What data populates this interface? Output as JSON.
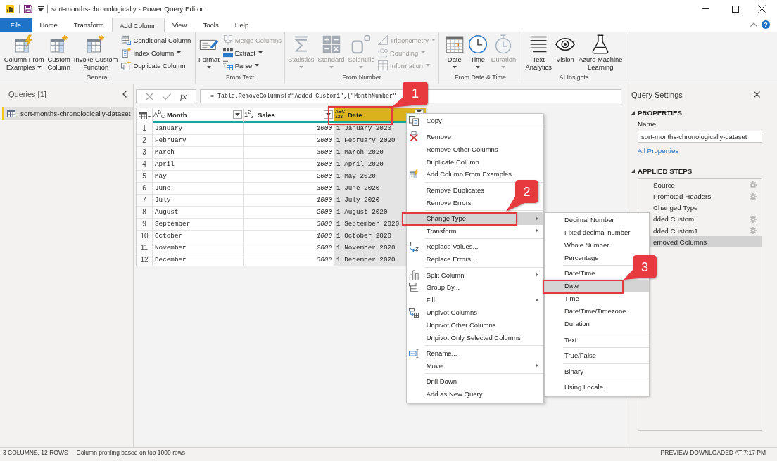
{
  "window": {
    "title": "sort-months-chronologically - Power Query Editor"
  },
  "tabs": [
    {
      "label": "File",
      "kind": "file",
      "selected": false
    },
    {
      "label": "Home",
      "kind": "tab",
      "selected": false
    },
    {
      "label": "Transform",
      "kind": "tab",
      "selected": false
    },
    {
      "label": "Add Column",
      "kind": "tab",
      "selected": true
    },
    {
      "label": "View",
      "kind": "tab",
      "selected": false
    },
    {
      "label": "Tools",
      "kind": "tab",
      "selected": false
    },
    {
      "label": "Help",
      "kind": "tab",
      "selected": false
    }
  ],
  "help_button": "?",
  "ribbon": {
    "groups": [
      {
        "label": "General",
        "large": [
          {
            "lines": [
              "Column From",
              "Examples"
            ],
            "dropdown": true,
            "disabled": false
          },
          {
            "lines": [
              "Custom",
              "Column"
            ],
            "dropdown": false,
            "disabled": false
          },
          {
            "lines": [
              "Invoke Custom",
              "Function"
            ],
            "dropdown": false,
            "disabled": false
          }
        ],
        "small": [
          {
            "label": "Conditional Column",
            "dropdown": false,
            "disabled": false
          },
          {
            "label": "Index Column",
            "dropdown": true,
            "disabled": false
          },
          {
            "label": "Duplicate Column",
            "dropdown": false,
            "disabled": false
          }
        ]
      },
      {
        "label": "From Text",
        "large": [
          {
            "lines": [
              "Format"
            ],
            "dropdown": true,
            "disabled": false
          }
        ],
        "small": [
          {
            "label": "Merge Columns",
            "dropdown": false,
            "disabled": true
          },
          {
            "label": "Extract",
            "dropdown": true,
            "disabled": false
          },
          {
            "label": "Parse",
            "dropdown": true,
            "disabled": false
          }
        ]
      },
      {
        "label": "From Number",
        "large": [
          {
            "lines": [
              "Statistics"
            ],
            "dropdown": true,
            "disabled": true
          },
          {
            "lines": [
              "Standard"
            ],
            "dropdown": true,
            "disabled": true
          },
          {
            "lines": [
              "Scientific"
            ],
            "dropdown": true,
            "disabled": true
          }
        ],
        "small": [
          {
            "label": "Trigonometry",
            "dropdown": true,
            "disabled": true
          },
          {
            "label": "Rounding",
            "dropdown": true,
            "disabled": true
          },
          {
            "label": "Information",
            "dropdown": true,
            "disabled": true
          }
        ]
      },
      {
        "label": "From Date & Time",
        "large": [
          {
            "lines": [
              "Date"
            ],
            "dropdown": true,
            "disabled": false
          },
          {
            "lines": [
              "Time"
            ],
            "dropdown": true,
            "disabled": false
          },
          {
            "lines": [
              "Duration"
            ],
            "dropdown": true,
            "disabled": true
          }
        ]
      },
      {
        "label": "AI Insights",
        "large": [
          {
            "lines": [
              "Text",
              "Analytics"
            ],
            "dropdown": false,
            "disabled": false
          },
          {
            "lines": [
              "Vision"
            ],
            "dropdown": false,
            "disabled": false
          },
          {
            "lines": [
              "Azure Machine",
              "Learning"
            ],
            "dropdown": false,
            "disabled": false
          }
        ]
      }
    ]
  },
  "queries": {
    "title": "Queries [1]",
    "items": [
      {
        "label": "sort-months-chronologically-dataset",
        "selected": true
      }
    ]
  },
  "formula_bar": {
    "function_button": "fx",
    "formula": "= Table.RemoveColumns(#\"Added Custom1\",{\"MonthNumber\""
  },
  "table": {
    "columns": [
      {
        "type_label": "A$^{B}$$_{C}$",
        "name": "Month",
        "kind": "text",
        "selected": false
      },
      {
        "type_label": "1$^{2}$$_{3}$",
        "name": "Sales",
        "kind": "number",
        "selected": false
      },
      {
        "type_label": "ABC 123",
        "name": "Date",
        "kind": "any",
        "selected": true
      }
    ],
    "rows": [
      {
        "number": "1",
        "cells": [
          "January",
          "1000",
          "1 January 2020"
        ]
      },
      {
        "number": "2",
        "cells": [
          "February",
          "2000",
          "1 February 2020"
        ]
      },
      {
        "number": "3",
        "cells": [
          "March",
          "3000",
          "1 March 2020"
        ]
      },
      {
        "number": "4",
        "cells": [
          "April",
          "1000",
          "1 April 2020"
        ]
      },
      {
        "number": "5",
        "cells": [
          "May",
          "2000",
          "1 May 2020"
        ]
      },
      {
        "number": "6",
        "cells": [
          "June",
          "3000",
          "1 June 2020"
        ]
      },
      {
        "number": "7",
        "cells": [
          "July",
          "1000",
          "1 July 2020"
        ]
      },
      {
        "number": "8",
        "cells": [
          "August",
          "2000",
          "1 August 2020"
        ]
      },
      {
        "number": "9",
        "cells": [
          "September",
          "3000",
          "1 September 2020"
        ]
      },
      {
        "number": "10",
        "cells": [
          "October",
          "1000",
          "1 October 2020"
        ]
      },
      {
        "number": "11",
        "cells": [
          "November",
          "2000",
          "1 November 2020"
        ]
      },
      {
        "number": "12",
        "cells": [
          "December",
          "3000",
          "1 December 2020"
        ]
      }
    ]
  },
  "context_menu": {
    "groups": [
      [
        {
          "label": "Copy",
          "has_submenu": false,
          "selected": false
        }
      ],
      [
        {
          "label": "Remove",
          "has_submenu": false,
          "selected": false
        },
        {
          "label": "Remove Other Columns",
          "has_submenu": false,
          "selected": false
        },
        {
          "label": "Duplicate Column",
          "has_submenu": false,
          "selected": false
        },
        {
          "label": "Add Column From Examples...",
          "has_submenu": false,
          "selected": false
        }
      ],
      [
        {
          "label": "Remove Duplicates",
          "has_submenu": false,
          "selected": false
        },
        {
          "label": "Remove Errors",
          "has_submenu": false,
          "selected": false
        }
      ],
      [
        {
          "label": "Change Type",
          "has_submenu": true,
          "selected": true
        },
        {
          "label": "Transform",
          "has_submenu": true,
          "selected": false
        }
      ],
      [
        {
          "label": "Replace Values...",
          "has_submenu": false,
          "selected": false
        },
        {
          "label": "Replace Errors...",
          "has_submenu": false,
          "selected": false
        }
      ],
      [
        {
          "label": "Split Column",
          "has_submenu": true,
          "selected": false
        },
        {
          "label": "Group By...",
          "has_submenu": false,
          "selected": false
        },
        {
          "label": "Fill",
          "has_submenu": true,
          "selected": false
        },
        {
          "label": "Unpivot Columns",
          "has_submenu": false,
          "selected": false
        },
        {
          "label": "Unpivot Other Columns",
          "has_submenu": false,
          "selected": false
        },
        {
          "label": "Unpivot Only Selected Columns",
          "has_submenu": false,
          "selected": false
        }
      ],
      [
        {
          "label": "Rename...",
          "has_submenu": false,
          "selected": false
        },
        {
          "label": "Move",
          "has_submenu": true,
          "selected": false
        }
      ],
      [
        {
          "label": "Drill Down",
          "has_submenu": false,
          "selected": false
        },
        {
          "label": "Add as New Query",
          "has_submenu": false,
          "selected": false
        }
      ]
    ]
  },
  "context_submenu": {
    "groups": [
      [
        {
          "label": "Decimal Number",
          "selected": false
        },
        {
          "label": "Fixed decimal number",
          "selected": false
        },
        {
          "label": "Whole Number",
          "selected": false
        },
        {
          "label": "Percentage",
          "selected": false
        }
      ],
      [
        {
          "label": "Date/Time",
          "selected": false
        },
        {
          "label": "Date",
          "selected": true
        },
        {
          "label": "Time",
          "selected": false
        },
        {
          "label": "Date/Time/Timezone",
          "selected": false
        },
        {
          "label": "Duration",
          "selected": false
        }
      ],
      [
        {
          "label": "Text",
          "selected": false
        }
      ],
      [
        {
          "label": "True/False",
          "selected": false
        }
      ],
      [
        {
          "label": "Binary",
          "selected": false
        }
      ],
      [
        {
          "label": "Using Locale...",
          "selected": false
        }
      ]
    ]
  },
  "query_settings": {
    "title": "Query Settings",
    "properties": {
      "heading": "PROPERTIES",
      "expanded": true,
      "name_label": "Name",
      "name_value": "sort-months-chronologically-dataset",
      "link": "All Properties"
    },
    "applied_steps": {
      "heading": "APPLIED STEPS",
      "expanded": true,
      "steps": [
        {
          "label": "Source",
          "settings": true,
          "selected": false
        },
        {
          "label": "Promoted Headers",
          "settings": true,
          "selected": false
        },
        {
          "label": "Changed Type",
          "settings": false,
          "selected": false
        },
        {
          "label": "dded Custom",
          "settings": true,
          "selected": false
        },
        {
          "label": "dded Custom1",
          "settings": true,
          "selected": false
        },
        {
          "label": "emoved Columns",
          "settings": false,
          "selected": true
        }
      ]
    }
  },
  "status_bar": {
    "left": [
      "3 COLUMNS, 12 ROWS",
      "Column profiling based on top 1000 rows"
    ],
    "right": "PREVIEW DOWNLOADED AT 7:17 PM"
  },
  "callouts": [
    {
      "number": "1"
    },
    {
      "number": "2"
    },
    {
      "number": "3"
    }
  ]
}
